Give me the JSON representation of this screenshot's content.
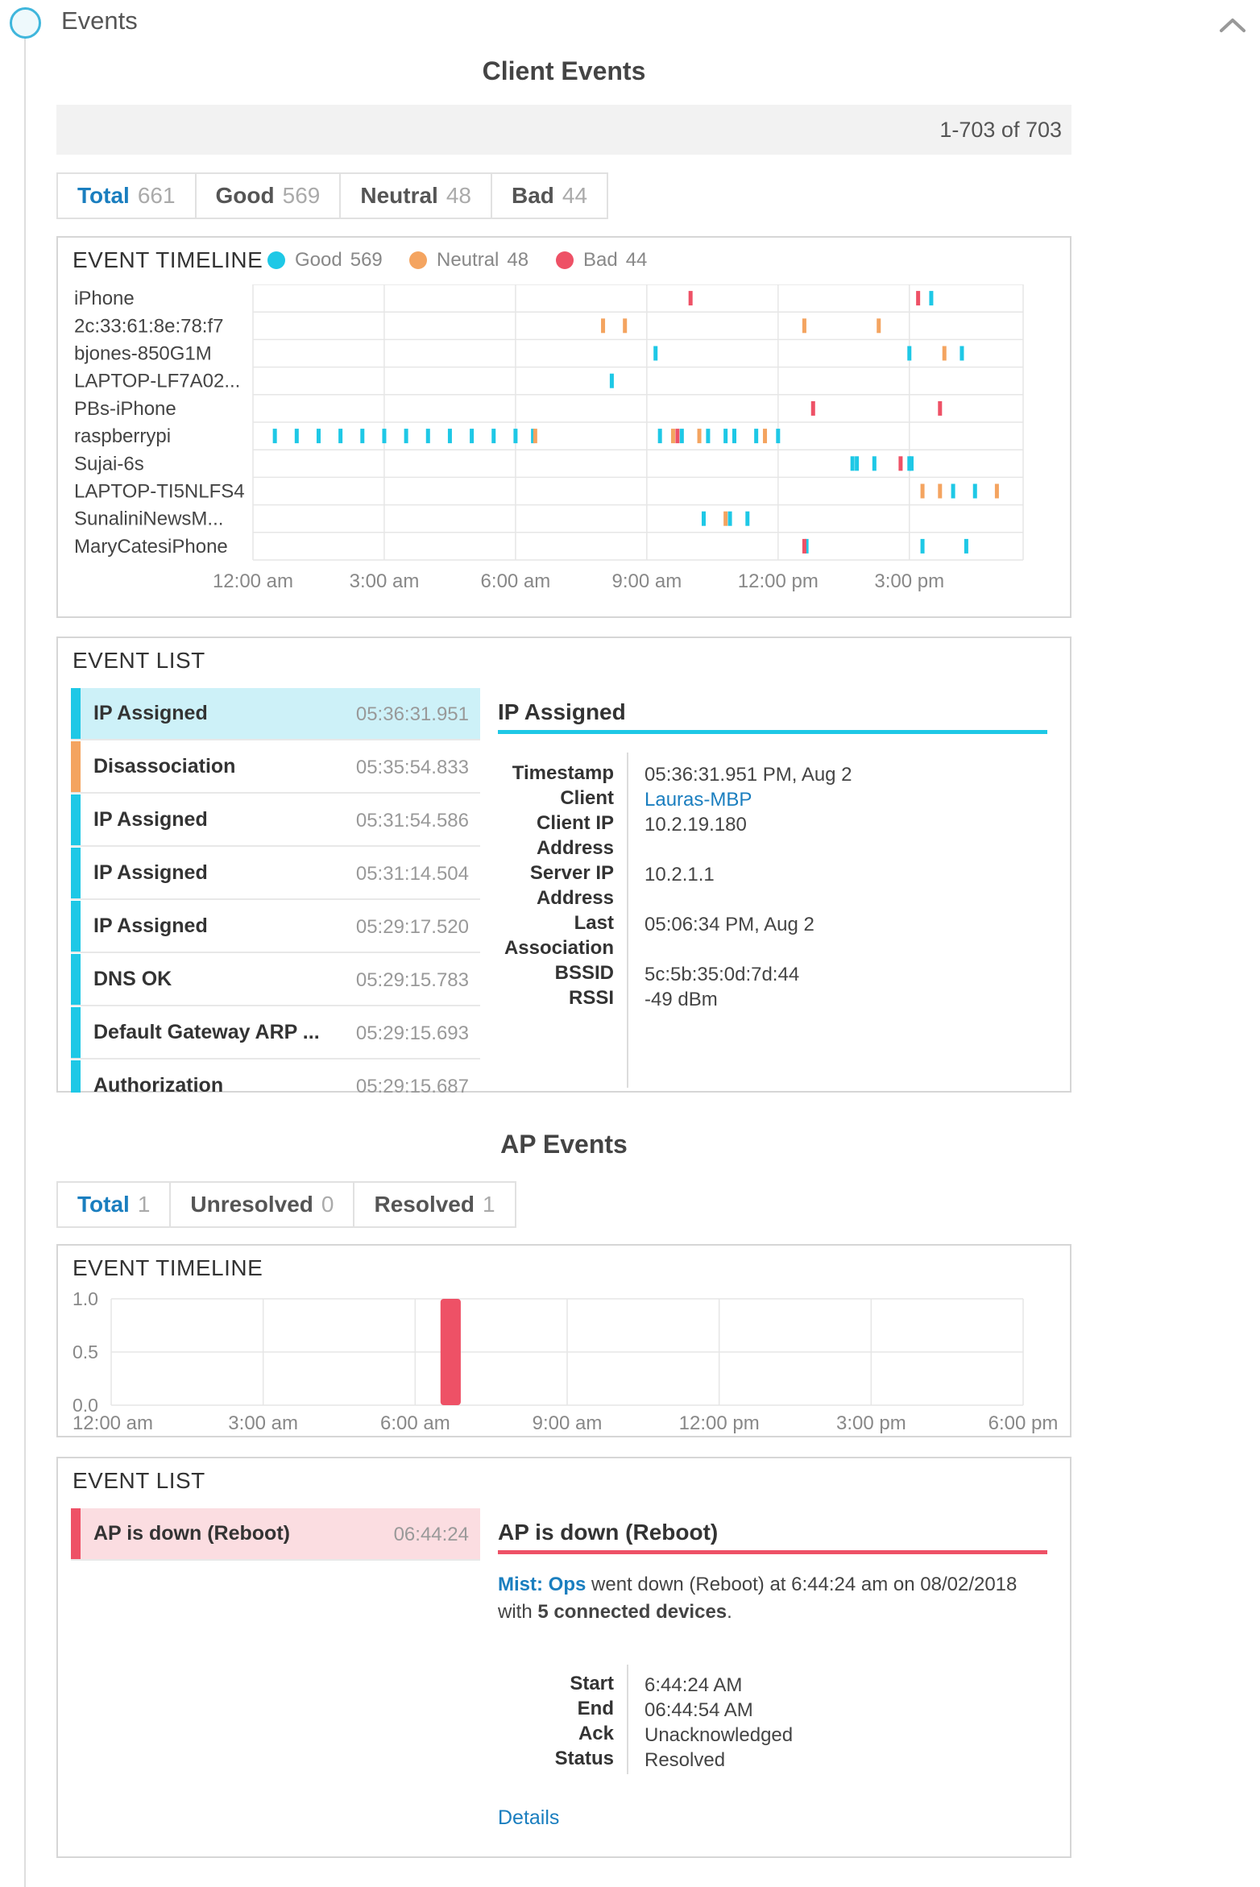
{
  "header": {
    "title": "Events"
  },
  "client_events": {
    "title": "Client Events",
    "pagination": "1-703 of 703",
    "tabs": [
      {
        "label": "Total",
        "count": "661"
      },
      {
        "label": "Good",
        "count": "569"
      },
      {
        "label": "Neutral",
        "count": "48"
      },
      {
        "label": "Bad",
        "count": "44"
      }
    ],
    "timeline": {
      "title": "EVENT TIMELINE",
      "legend": [
        {
          "label": "Good",
          "count": "569",
          "color": "#1ec8e6"
        },
        {
          "label": "Neutral",
          "count": "48",
          "color": "#f4a460"
        },
        {
          "label": "Bad",
          "count": "44",
          "color": "#ee5166"
        }
      ],
      "x_ticks": [
        "12:00 am",
        "3:00 am",
        "6:00 am",
        "9:00 am",
        "12:00 pm",
        "3:00 pm"
      ]
    },
    "event_list": {
      "title": "EVENT LIST",
      "items": [
        {
          "name": "IP Assigned",
          "time": "05:36:31.951",
          "status": "good",
          "selected": true
        },
        {
          "name": "Disassociation",
          "time": "05:35:54.833",
          "status": "neutral"
        },
        {
          "name": "IP Assigned",
          "time": "05:31:54.586",
          "status": "good"
        },
        {
          "name": "IP Assigned",
          "time": "05:31:14.504",
          "status": "good"
        },
        {
          "name": "IP Assigned",
          "time": "05:29:17.520",
          "status": "good"
        },
        {
          "name": "DNS OK",
          "time": "05:29:15.783",
          "status": "good"
        },
        {
          "name": "Default Gateway ARP ...",
          "time": "05:29:15.693",
          "status": "good"
        },
        {
          "name": "Authorization",
          "time": "05:29:15.687",
          "status": "good"
        }
      ],
      "detail": {
        "title": "IP Assigned",
        "fields": [
          {
            "label": "Timestamp",
            "value": "05:36:31.951 PM, Aug 2"
          },
          {
            "label": "Client",
            "value": "Lauras-MBP",
            "link": true
          },
          {
            "label": "Client IP\nAddress",
            "value": "10.2.19.180"
          },
          {
            "label": "Server IP\nAddress",
            "value": "10.2.1.1"
          },
          {
            "label": "Last\nAssociation",
            "value": "05:06:34 PM, Aug 2"
          },
          {
            "label": "BSSID",
            "value": "5c:5b:35:0d:7d:44"
          },
          {
            "label": "RSSI",
            "value": "-49 dBm"
          }
        ]
      }
    }
  },
  "ap_events": {
    "title": "AP Events",
    "tabs": [
      {
        "label": "Total",
        "count": "1"
      },
      {
        "label": "Unresolved",
        "count": "0"
      },
      {
        "label": "Resolved",
        "count": "1"
      }
    ],
    "timeline": {
      "title": "EVENT TIMELINE"
    },
    "event_list": {
      "title": "EVENT LIST",
      "items": [
        {
          "name": "AP is down (Reboot)",
          "time": "06:44:24",
          "status": "bad",
          "selected": true
        }
      ],
      "detail": {
        "title": "AP is down (Reboot)",
        "summary": {
          "site": "Mist: Ops",
          "text1": " went down (Reboot) at 6:44:24 am on 08/02/2018",
          "text2": "with ",
          "devices": "5 connected devices",
          "text3": "."
        },
        "fields": [
          {
            "label": "Start",
            "value": "6:44:24 AM"
          },
          {
            "label": "End",
            "value": "06:44:54 AM"
          },
          {
            "label": "Ack",
            "value": "Unacknowledged"
          },
          {
            "label": "Status",
            "value": "Resolved"
          }
        ],
        "details_link": "Details"
      }
    }
  },
  "chart_data": [
    {
      "type": "scatter",
      "title": "EVENT TIMELINE",
      "x_unit": "hours since 12:00 am",
      "xlim": [
        0,
        17.6
      ],
      "x_ticks": [
        "12:00 am",
        "3:00 am",
        "6:00 am",
        "9:00 am",
        "12:00 pm",
        "3:00 pm"
      ],
      "categories": [
        "iPhone",
        "2c:33:61:8e:78:f7",
        "bjones-850G1M",
        "LAPTOP-LF7A02...",
        "PBs-iPhone",
        "raspberrypi",
        "Sujai-6s",
        "LAPTOP-TI5NLFS4",
        "SunaliniNewsM...",
        "MaryCatesiPhone"
      ],
      "series": [
        {
          "name": "Good",
          "color": "#1ec8e6",
          "points": [
            [
              0,
              15.5
            ],
            [
              2,
              9.2
            ],
            [
              2,
              15.0
            ],
            [
              2,
              16.2
            ],
            [
              3,
              8.2
            ],
            [
              5,
              0.5
            ],
            [
              5,
              1.0
            ],
            [
              5,
              1.5
            ],
            [
              5,
              2.0
            ],
            [
              5,
              2.5
            ],
            [
              5,
              3.0
            ],
            [
              5,
              3.5
            ],
            [
              5,
              4.0
            ],
            [
              5,
              4.5
            ],
            [
              5,
              5.0
            ],
            [
              5,
              5.5
            ],
            [
              5,
              6.0
            ],
            [
              5,
              6.4
            ],
            [
              5,
              9.3
            ],
            [
              5,
              9.8
            ],
            [
              5,
              10.4
            ],
            [
              5,
              10.8
            ],
            [
              5,
              11.0
            ],
            [
              5,
              11.5
            ],
            [
              5,
              12.0
            ],
            [
              6,
              13.7
            ],
            [
              6,
              13.8
            ],
            [
              6,
              14.2
            ],
            [
              6,
              15.0
            ],
            [
              6,
              15.05
            ],
            [
              7,
              16.0
            ],
            [
              7,
              16.5
            ],
            [
              8,
              10.3
            ],
            [
              8,
              10.9
            ],
            [
              8,
              11.3
            ],
            [
              9,
              12.65
            ],
            [
              9,
              15.3
            ],
            [
              9,
              16.3
            ]
          ]
        },
        {
          "name": "Neutral",
          "color": "#f4a460",
          "points": [
            [
              1,
              8.0
            ],
            [
              1,
              8.5
            ],
            [
              1,
              12.6
            ],
            [
              1,
              14.3
            ],
            [
              2,
              15.8
            ],
            [
              5,
              6.45
            ],
            [
              5,
              9.6
            ],
            [
              5,
              10.2
            ],
            [
              5,
              11.7
            ],
            [
              7,
              15.3
            ],
            [
              7,
              15.7
            ],
            [
              7,
              17.0
            ],
            [
              8,
              10.8
            ]
          ]
        },
        {
          "name": "Bad",
          "color": "#ee5166",
          "points": [
            [
              0,
              10.0
            ],
            [
              0,
              15.2
            ],
            [
              4,
              12.8
            ],
            [
              4,
              15.7
            ],
            [
              5,
              9.7
            ],
            [
              6,
              14.8
            ],
            [
              9,
              12.6
            ]
          ]
        }
      ]
    },
    {
      "type": "bar",
      "title": "EVENT TIMELINE",
      "x_ticks": [
        "12:00 am",
        "3:00 am",
        "6:00 am",
        "9:00 am",
        "12:00 pm",
        "3:00 pm",
        "6:00 pm"
      ],
      "xlim": [
        0,
        18
      ],
      "ylim": [
        0,
        1
      ],
      "y_ticks": [
        "0.0",
        "0.5",
        "1.0"
      ],
      "bars": [
        {
          "x_start": 6.5,
          "x_end": 6.9,
          "value": 1,
          "color": "#ee5166"
        }
      ]
    }
  ],
  "colors": {
    "good": "#1ec8e6",
    "neutral": "#f4a460",
    "bad": "#ee5166",
    "link": "#1a7ebf",
    "accent": "#3fb6dc"
  }
}
